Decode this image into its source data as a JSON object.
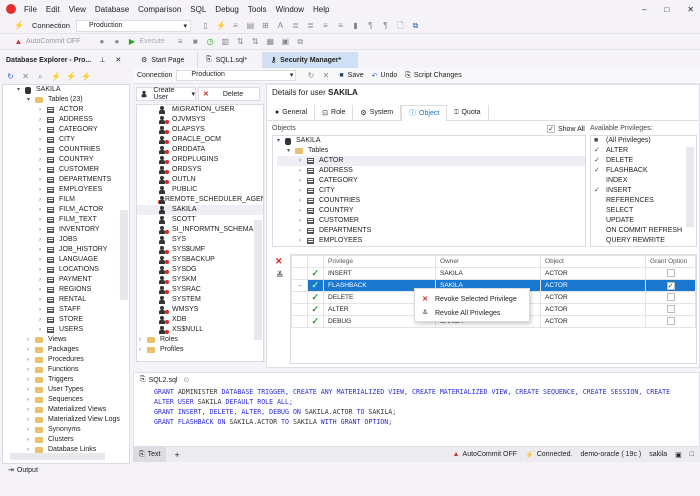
{
  "app": {
    "menu": [
      "File",
      "Edit",
      "View",
      "Database",
      "Comparison",
      "SQL",
      "Debug",
      "Tools",
      "Window",
      "Help"
    ],
    "window_controls": [
      "minimize",
      "maximize",
      "close"
    ]
  },
  "toolbar": {
    "connection_label": "Connection",
    "connection_value": "Production",
    "autocommit": "AutoCommit OFF",
    "execute": "Execute"
  },
  "tabs": [
    {
      "label": "Start Page"
    },
    {
      "label": "SQL1.sql*"
    },
    {
      "label": "Security Manager*",
      "active": true
    }
  ],
  "explorer": {
    "title": "Database Explorer - Pro...",
    "root": "SAKILA",
    "tables_label": "Tables (23)",
    "tables": [
      "ACTOR",
      "ADDRESS",
      "CATEGORY",
      "CITY",
      "COUNTRIES",
      "COUNTRY",
      "CUSTOMER",
      "DEPARTMENTS",
      "EMPLOYEES",
      "FILM",
      "FILM_ACTOR",
      "FILM_TEXT",
      "INVENTORY",
      "JOBS",
      "JOB_HISTORY",
      "LANGUAGE",
      "LOCATIONS",
      "PAYMENT",
      "REGIONS",
      "RENTAL",
      "STAFF",
      "STORE",
      "USERS"
    ],
    "folders": [
      "Views",
      "Packages",
      "Procedures",
      "Functions",
      "Triggers",
      "User Types",
      "Sequences",
      "Materialized Views",
      "Materialized View Logs",
      "Synonyms",
      "Clusters",
      "Database Links"
    ]
  },
  "security": {
    "connection_label": "Connection",
    "connection_value": "Production",
    "save": "Save",
    "undo": "Undo",
    "script_changes": "Script Changes",
    "create_user": "Create User",
    "delete": "Delete",
    "users": [
      {
        "name": "MIGRATION_USER",
        "locked": false
      },
      {
        "name": "OJVMSYS",
        "locked": true
      },
      {
        "name": "OLAPSYS",
        "locked": true
      },
      {
        "name": "ORACLE_OCM",
        "locked": true
      },
      {
        "name": "ORDDATA",
        "locked": true
      },
      {
        "name": "ORDPLUGINS",
        "locked": true
      },
      {
        "name": "ORDSYS",
        "locked": true
      },
      {
        "name": "OUTLN",
        "locked": true
      },
      {
        "name": "PUBLIC",
        "locked": false
      },
      {
        "name": "REMOTE_SCHEDULER_AGENT",
        "locked": true
      },
      {
        "name": "SAKILA",
        "locked": false
      },
      {
        "name": "SCOTT",
        "locked": false
      },
      {
        "name": "SI_INFORMTN_SCHEMA",
        "locked": true
      },
      {
        "name": "SYS",
        "locked": false
      },
      {
        "name": "SYS$UMF",
        "locked": true
      },
      {
        "name": "SYSBACKUP",
        "locked": true
      },
      {
        "name": "SYSDG",
        "locked": true
      },
      {
        "name": "SYSKM",
        "locked": true
      },
      {
        "name": "SYSRAC",
        "locked": true
      },
      {
        "name": "SYSTEM",
        "locked": false
      },
      {
        "name": "WMSYS",
        "locked": true
      },
      {
        "name": "XDB",
        "locked": true
      },
      {
        "name": "XS$NULL",
        "locked": true
      }
    ],
    "user_folders": [
      "Roles",
      "Profiles"
    ],
    "details_prefix": "Details for user ",
    "details_user": "SAKILA",
    "detail_tabs": [
      "General",
      "Role",
      "System",
      "Object",
      "Quota"
    ],
    "active_detail_tab": "Object",
    "objects_label": "Objects",
    "show_all": "Show All",
    "objects_root": "SAKILA",
    "objects_folder": "Tables",
    "objects": [
      "ACTOR",
      "ADDRESS",
      "CATEGORY",
      "CITY",
      "COUNTRIES",
      "COUNTRY",
      "CUSTOMER",
      "DEPARTMENTS",
      "EMPLOYEES"
    ],
    "available_label": "Available Privileges:",
    "available": [
      {
        "name": "(All Privileges)",
        "state": "partial"
      },
      {
        "name": "ALTER",
        "state": "checked"
      },
      {
        "name": "DELETE",
        "state": "checked"
      },
      {
        "name": "FLASHBACK",
        "state": "checked"
      },
      {
        "name": "INDEX",
        "state": ""
      },
      {
        "name": "INSERT",
        "state": "checked"
      },
      {
        "name": "REFERENCES",
        "state": ""
      },
      {
        "name": "SELECT",
        "state": ""
      },
      {
        "name": "UPDATE",
        "state": ""
      },
      {
        "name": "ON COMMIT REFRESH",
        "state": ""
      },
      {
        "name": "QUERY REWRITE",
        "state": ""
      }
    ],
    "grid_headers": [
      "Privilege",
      "Owner",
      "Object",
      "Grant Option"
    ],
    "grid": [
      {
        "privilege": "INSERT",
        "owner": "SAKILA",
        "object": "ACTOR",
        "grant": false
      },
      {
        "privilege": "FLASHBACK",
        "owner": "SAKILA",
        "object": "ACTOR",
        "grant": true,
        "selected": true
      },
      {
        "privilege": "DELETE",
        "owner": "SAKILA",
        "object": "ACTOR",
        "grant": false
      },
      {
        "privilege": "ALTER",
        "owner": "SAKILA",
        "object": "ACTOR",
        "grant": false
      },
      {
        "privilege": "DEBUG",
        "owner": "SAKILA",
        "object": "ACTOR",
        "grant": false
      }
    ],
    "context_menu": [
      "Revoke Selected Privilege",
      "Revoke All Privileges"
    ]
  },
  "sql": {
    "tab": "SQL2.sql",
    "lines": [
      [
        [
          "k",
          "GRANT "
        ],
        [
          "t",
          "ADMINISTER "
        ],
        [
          "k",
          "DATABASE TRIGGER, CREATE ANY MATERIALIZED VIEW, CREATE MATERIALIZED VIEW, CREATE SEQUENCE, CREATE SESSION, CREATE"
        ]
      ],
      [
        [
          "k",
          "ALTER USER "
        ],
        [
          "t",
          "SAKILA "
        ],
        [
          "k",
          "DEFAULT ROLE ALL;"
        ]
      ],
      [
        [
          "k",
          "GRANT INSERT, DELETE, ALTER, DEBUG ON "
        ],
        [
          "t",
          "SAKILA.ACTOR "
        ],
        [
          "k",
          "TO "
        ],
        [
          "t",
          "SAKILA;"
        ]
      ],
      [
        [
          "k",
          "GRANT FLASHBACK ON "
        ],
        [
          "t",
          "SAKILA.ACTOR "
        ],
        [
          "k",
          "TO "
        ],
        [
          "t",
          "SAKILA "
        ],
        [
          "k",
          "WITH GRANT OPTION;"
        ]
      ]
    ]
  },
  "status": {
    "text_tab": "Text",
    "autocommit": "AutoCommit OFF",
    "connected": "Connected.",
    "server": "demo-oracle ( 19c )",
    "user": "sakila"
  },
  "output": "Output"
}
